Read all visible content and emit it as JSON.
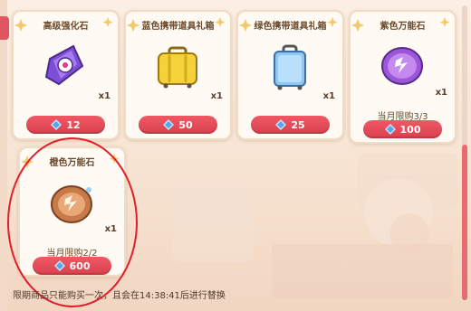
{
  "items": [
    {
      "title": "高级强化石",
      "quantity": "x1",
      "limit": "",
      "price": "12",
      "icon": "purple-crystal-icon"
    },
    {
      "title": "蓝色携带道具礼箱",
      "quantity": "x1",
      "limit": "",
      "price": "50",
      "icon": "yellow-suitcase-icon"
    },
    {
      "title": "绿色携带道具礼箱",
      "quantity": "x1",
      "limit": "",
      "price": "25",
      "icon": "blue-suitcase-icon"
    },
    {
      "title": "紫色万能石",
      "quantity": "x1",
      "limit": "当月限购3/3",
      "price": "100",
      "icon": "purple-stone-icon"
    },
    {
      "title": "橙色万能石",
      "quantity": "x1",
      "limit": "当月限购2/2",
      "price": "600",
      "icon": "orange-stone-icon"
    }
  ],
  "footer": {
    "note": "限期商品只能购买一次，且会在14:38:41后进行替换"
  },
  "colors": {
    "accent": "#e6505c",
    "card_bg": "#fffaf3",
    "title": "#6b4a2e",
    "highlight": "#e01f2a"
  }
}
